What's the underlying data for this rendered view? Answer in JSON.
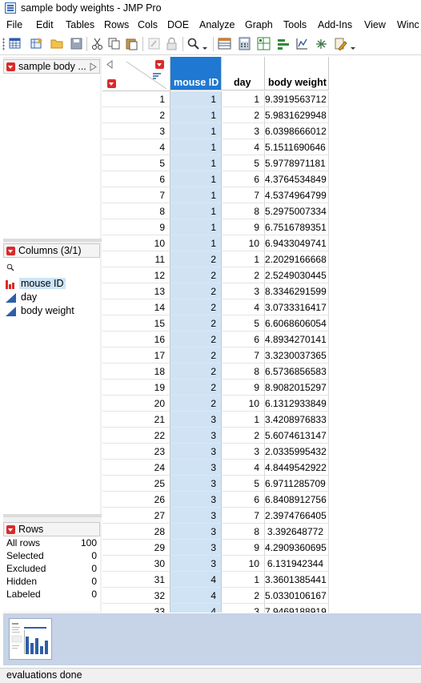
{
  "window": {
    "title": "sample body weights - JMP Pro"
  },
  "menu": [
    "File",
    "Edit",
    "Tables",
    "Rows",
    "Cols",
    "DOE",
    "Analyze",
    "Graph",
    "Tools",
    "Add-Ins",
    "View",
    "Winc"
  ],
  "toolbar": {
    "buttons": [
      "new-table-icon",
      "open-table-icon",
      "open-folder-icon",
      "save-icon",
      "cut-icon",
      "copy-icon",
      "paste-icon",
      "format-icon",
      "lock-icon",
      "search-icon",
      "dropdown-icon",
      "data-grid-icon",
      "calculator-icon",
      "graph-builder-icon",
      "bar-chart-icon",
      "distribution-icon",
      "scatter-icon",
      "script-icon",
      "dropdown-icon"
    ]
  },
  "table_panel": {
    "label": "sample body ..."
  },
  "columns_panel": {
    "title": "Columns (3/1)",
    "columns": [
      {
        "name": "mouse ID",
        "type": "nominal",
        "selected": true
      },
      {
        "name": "day",
        "type": "continuous",
        "selected": false
      },
      {
        "name": "body weight",
        "type": "continuous",
        "selected": false
      }
    ]
  },
  "rows_panel": {
    "title": "Rows",
    "stats": [
      {
        "label": "All rows",
        "value": "100"
      },
      {
        "label": "Selected",
        "value": "0"
      },
      {
        "label": "Excluded",
        "value": "0"
      },
      {
        "label": "Hidden",
        "value": "0"
      },
      {
        "label": "Labeled",
        "value": "0"
      }
    ]
  },
  "grid": {
    "headers": [
      "mouse ID",
      "day",
      "body weight"
    ],
    "rows": [
      [
        "1",
        "1",
        "1",
        "9.3919563712"
      ],
      [
        "2",
        "1",
        "2",
        "5.9831629948"
      ],
      [
        "3",
        "1",
        "3",
        "6.0398666012"
      ],
      [
        "4",
        "1",
        "4",
        "5.1511690646"
      ],
      [
        "5",
        "1",
        "5",
        "5.9778971181"
      ],
      [
        "6",
        "1",
        "6",
        "4.3764534849"
      ],
      [
        "7",
        "1",
        "7",
        "4.5374964799"
      ],
      [
        "8",
        "1",
        "8",
        "5.2975007334"
      ],
      [
        "9",
        "1",
        "9",
        "6.7516789351"
      ],
      [
        "10",
        "1",
        "10",
        "6.9433049741"
      ],
      [
        "11",
        "2",
        "1",
        "2.2029166668"
      ],
      [
        "12",
        "2",
        "2",
        "2.5249030445"
      ],
      [
        "13",
        "2",
        "3",
        "8.3346291599"
      ],
      [
        "14",
        "2",
        "4",
        "3.0733316417"
      ],
      [
        "15",
        "2",
        "5",
        "6.6068606054"
      ],
      [
        "16",
        "2",
        "6",
        "4.8934270141"
      ],
      [
        "17",
        "2",
        "7",
        "3.3230037365"
      ],
      [
        "18",
        "2",
        "8",
        "6.5736856583"
      ],
      [
        "19",
        "2",
        "9",
        "8.9082015297"
      ],
      [
        "20",
        "2",
        "10",
        "6.1312933849"
      ],
      [
        "21",
        "3",
        "1",
        "3.4208976833"
      ],
      [
        "22",
        "3",
        "2",
        "5.6074613147"
      ],
      [
        "23",
        "3",
        "3",
        "2.0335995432"
      ],
      [
        "24",
        "3",
        "4",
        "4.8449542922"
      ],
      [
        "25",
        "3",
        "5",
        "6.9711285709"
      ],
      [
        "26",
        "3",
        "6",
        "6.8408912756"
      ],
      [
        "27",
        "3",
        "7",
        "2.3974766405"
      ],
      [
        "28",
        "3",
        "8",
        "3.392648772"
      ],
      [
        "29",
        "3",
        "9",
        "4.2909360695"
      ],
      [
        "30",
        "3",
        "10",
        "6.131942344"
      ],
      [
        "31",
        "4",
        "1",
        "3.3601385441"
      ],
      [
        "32",
        "4",
        "2",
        "5.0330106167"
      ],
      [
        "33",
        "4",
        "3",
        "7.9469188919"
      ]
    ]
  },
  "status": {
    "text": "evaluations done"
  }
}
